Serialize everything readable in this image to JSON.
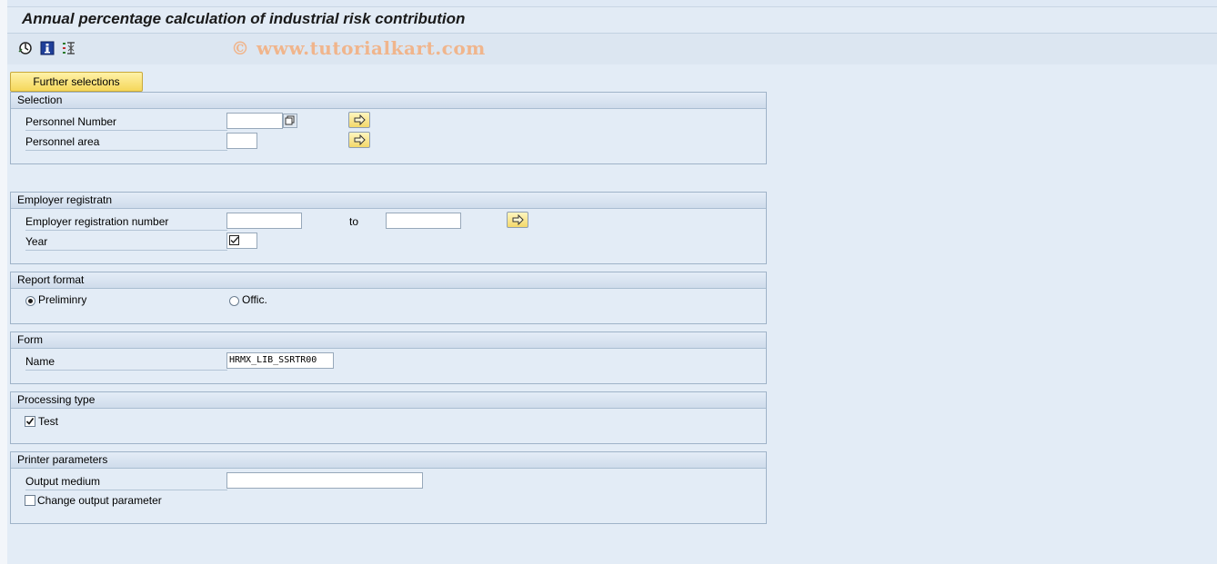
{
  "title": "Annual percentage calculation of industrial risk contribution",
  "watermark": "© www.tutorialkart.com",
  "toolbar": {
    "icons": [
      "execute-icon",
      "info-icon",
      "selection-options-icon"
    ]
  },
  "further_selections_label": "Further selections",
  "groups": {
    "selection": {
      "title": "Selection",
      "personnel_number_label": "Personnel Number",
      "personnel_number_value": "",
      "personnel_area_label": "Personnel area",
      "personnel_area_value": ""
    },
    "employer": {
      "title": "Employer registratn",
      "reg_number_label": "Employer registration number",
      "reg_number_from": "",
      "to_label": "to",
      "reg_number_to": "",
      "year_label": "Year"
    },
    "report_format": {
      "title": "Report format",
      "option_preliminary": "Preliminry",
      "option_official": "Offic.",
      "selected": "Preliminry"
    },
    "form": {
      "title": "Form",
      "name_label": "Name",
      "name_value": "HRMX_LIB_SSRTR00"
    },
    "processing": {
      "title": "Processing type",
      "test_label": "Test",
      "test_checked": true
    },
    "printer": {
      "title": "Printer parameters",
      "output_medium_label": "Output medium",
      "output_medium_value": "",
      "change_output_label": "Change output parameter",
      "change_output_checked": false
    }
  },
  "colors": {
    "background": "#dfe9f5",
    "button_yellow": "#f5d75a",
    "watermark": "#f0b58c"
  }
}
